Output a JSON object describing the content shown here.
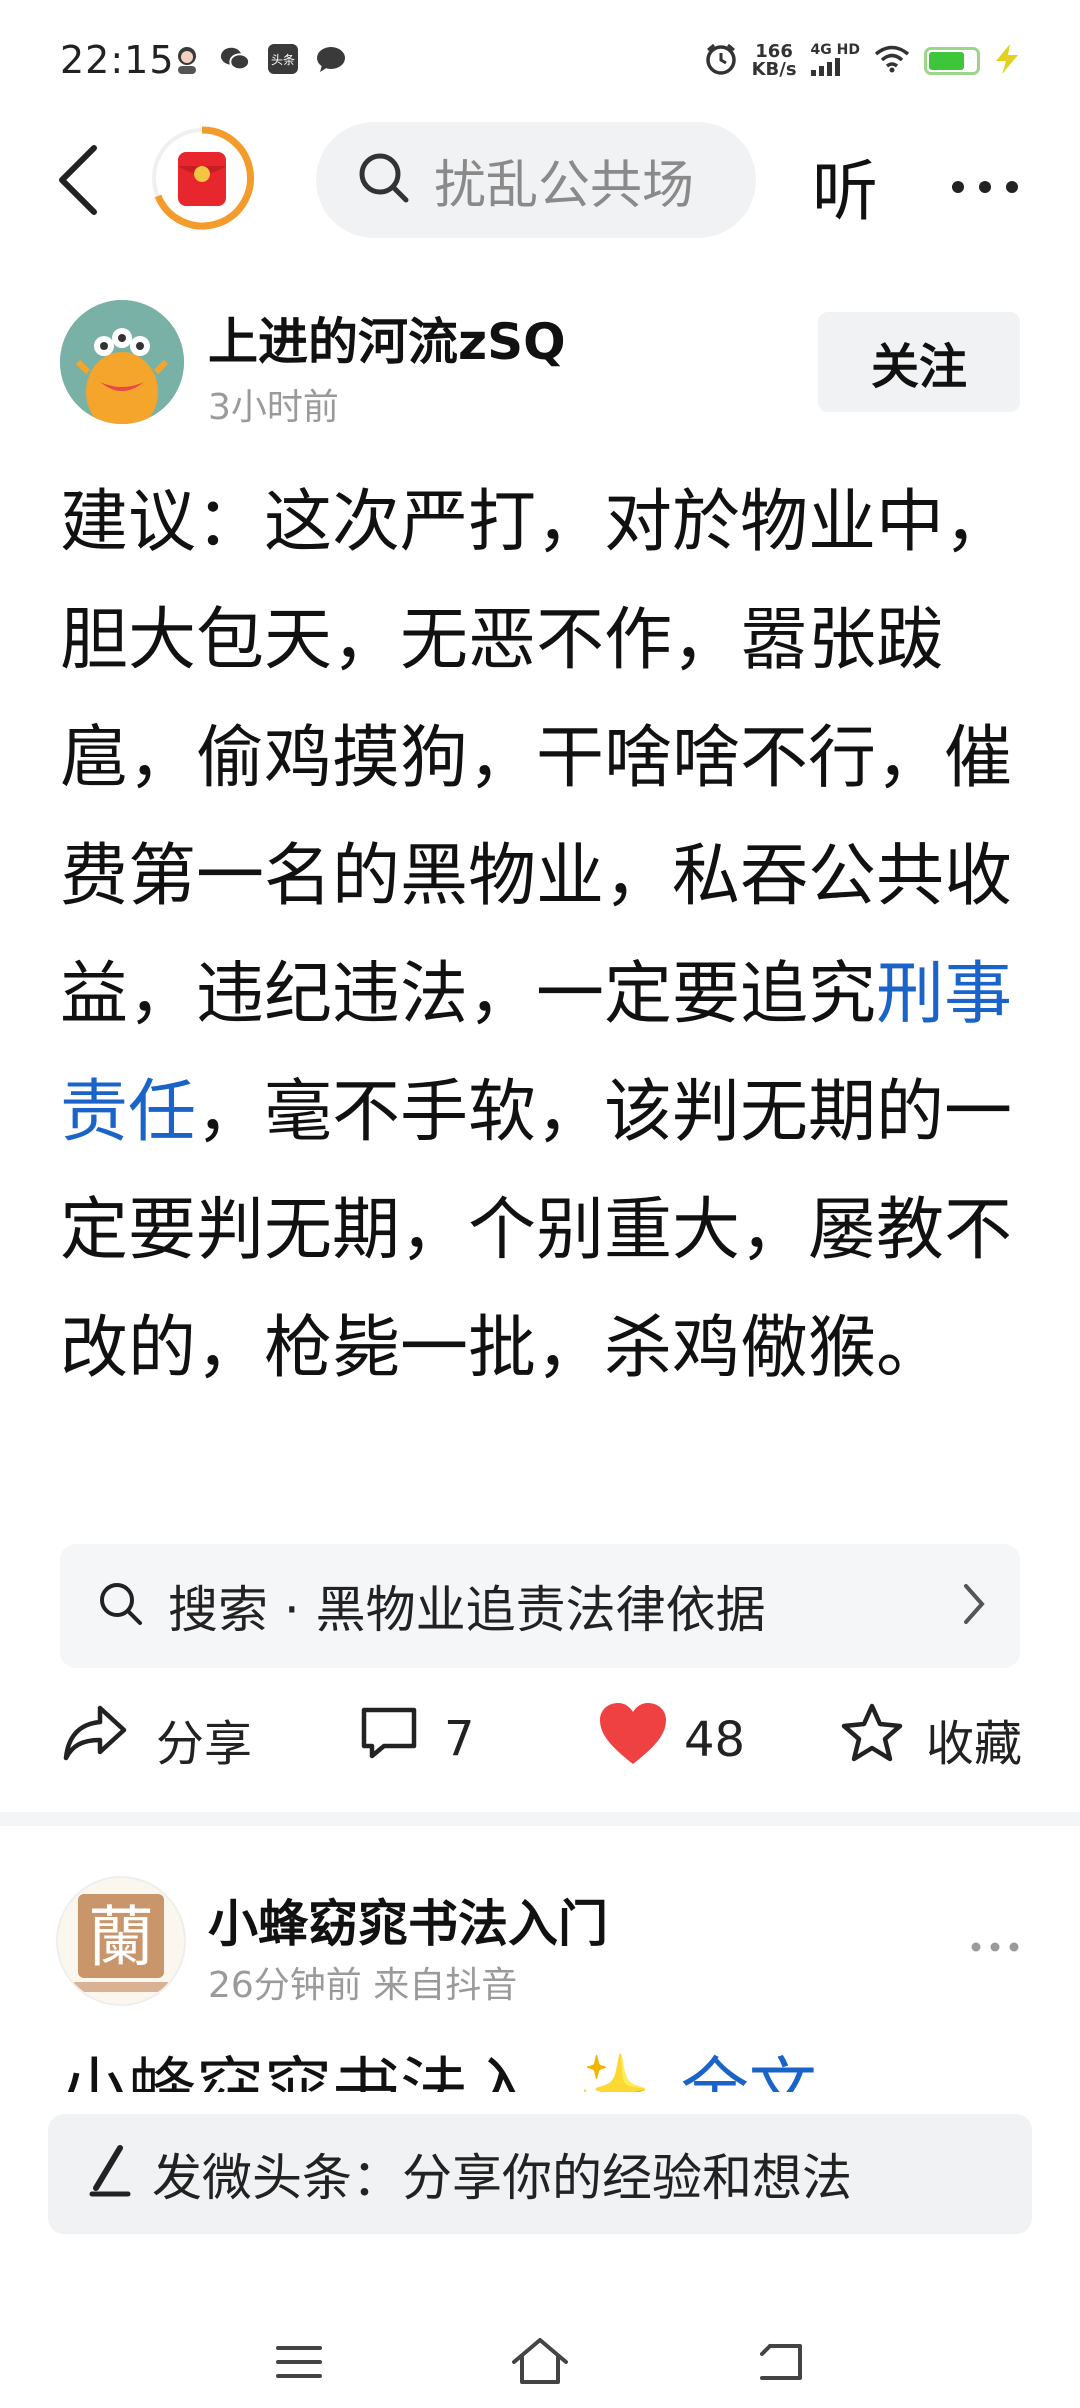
{
  "status_bar": {
    "time": "22:15",
    "speed_value": "166",
    "speed_unit": "KB/s",
    "network": "4G HD",
    "icons": [
      "avatar-notification-icon",
      "wechat-icon",
      "toutiao-icon",
      "message-icon",
      "alarm-icon",
      "signal-icon",
      "wifi-icon",
      "battery-icon",
      "charging-icon"
    ],
    "battery_color": "#3fc53a"
  },
  "header": {
    "search_placeholder": "扰乱公共场",
    "listen_label": "听",
    "more_label": "···"
  },
  "post": {
    "author": "上进的河流zSQ",
    "time": "3小时前",
    "follow_label": "关注",
    "text_before": "建议：这次严打，对於物业中，胆大包天，无恶不作，嚣张跋扈，偷鸡摸狗，干啥啥不行，催费第一名的黑物业，私吞公共收益，违纪违法，一定要追究",
    "text_highlight": "刑事责任",
    "text_after": "，毫不手软，该判无期的一定要判无期，个别重大，屡教不改的，枪毙一批，杀鸡儆猴。",
    "highlight_color": "#1a63c9",
    "related_search": "搜索 · 黑物业追责法律依据",
    "share_label": "分享",
    "comment_count": "7",
    "like_count": "48",
    "collect_label": "收藏",
    "like_color": "#f04142"
  },
  "post2": {
    "author": "小蜂窈窕书法入门",
    "time": "26分钟前  来自抖音",
    "avatar_char": "蘭",
    "preview_text": "小蜂窈窕书法入",
    "preview_link": "全文"
  },
  "compose": {
    "text": "发微头条：分享你的经验和想法"
  },
  "nav": {
    "icons": [
      "menu-icon",
      "home-icon",
      "back-icon"
    ]
  }
}
